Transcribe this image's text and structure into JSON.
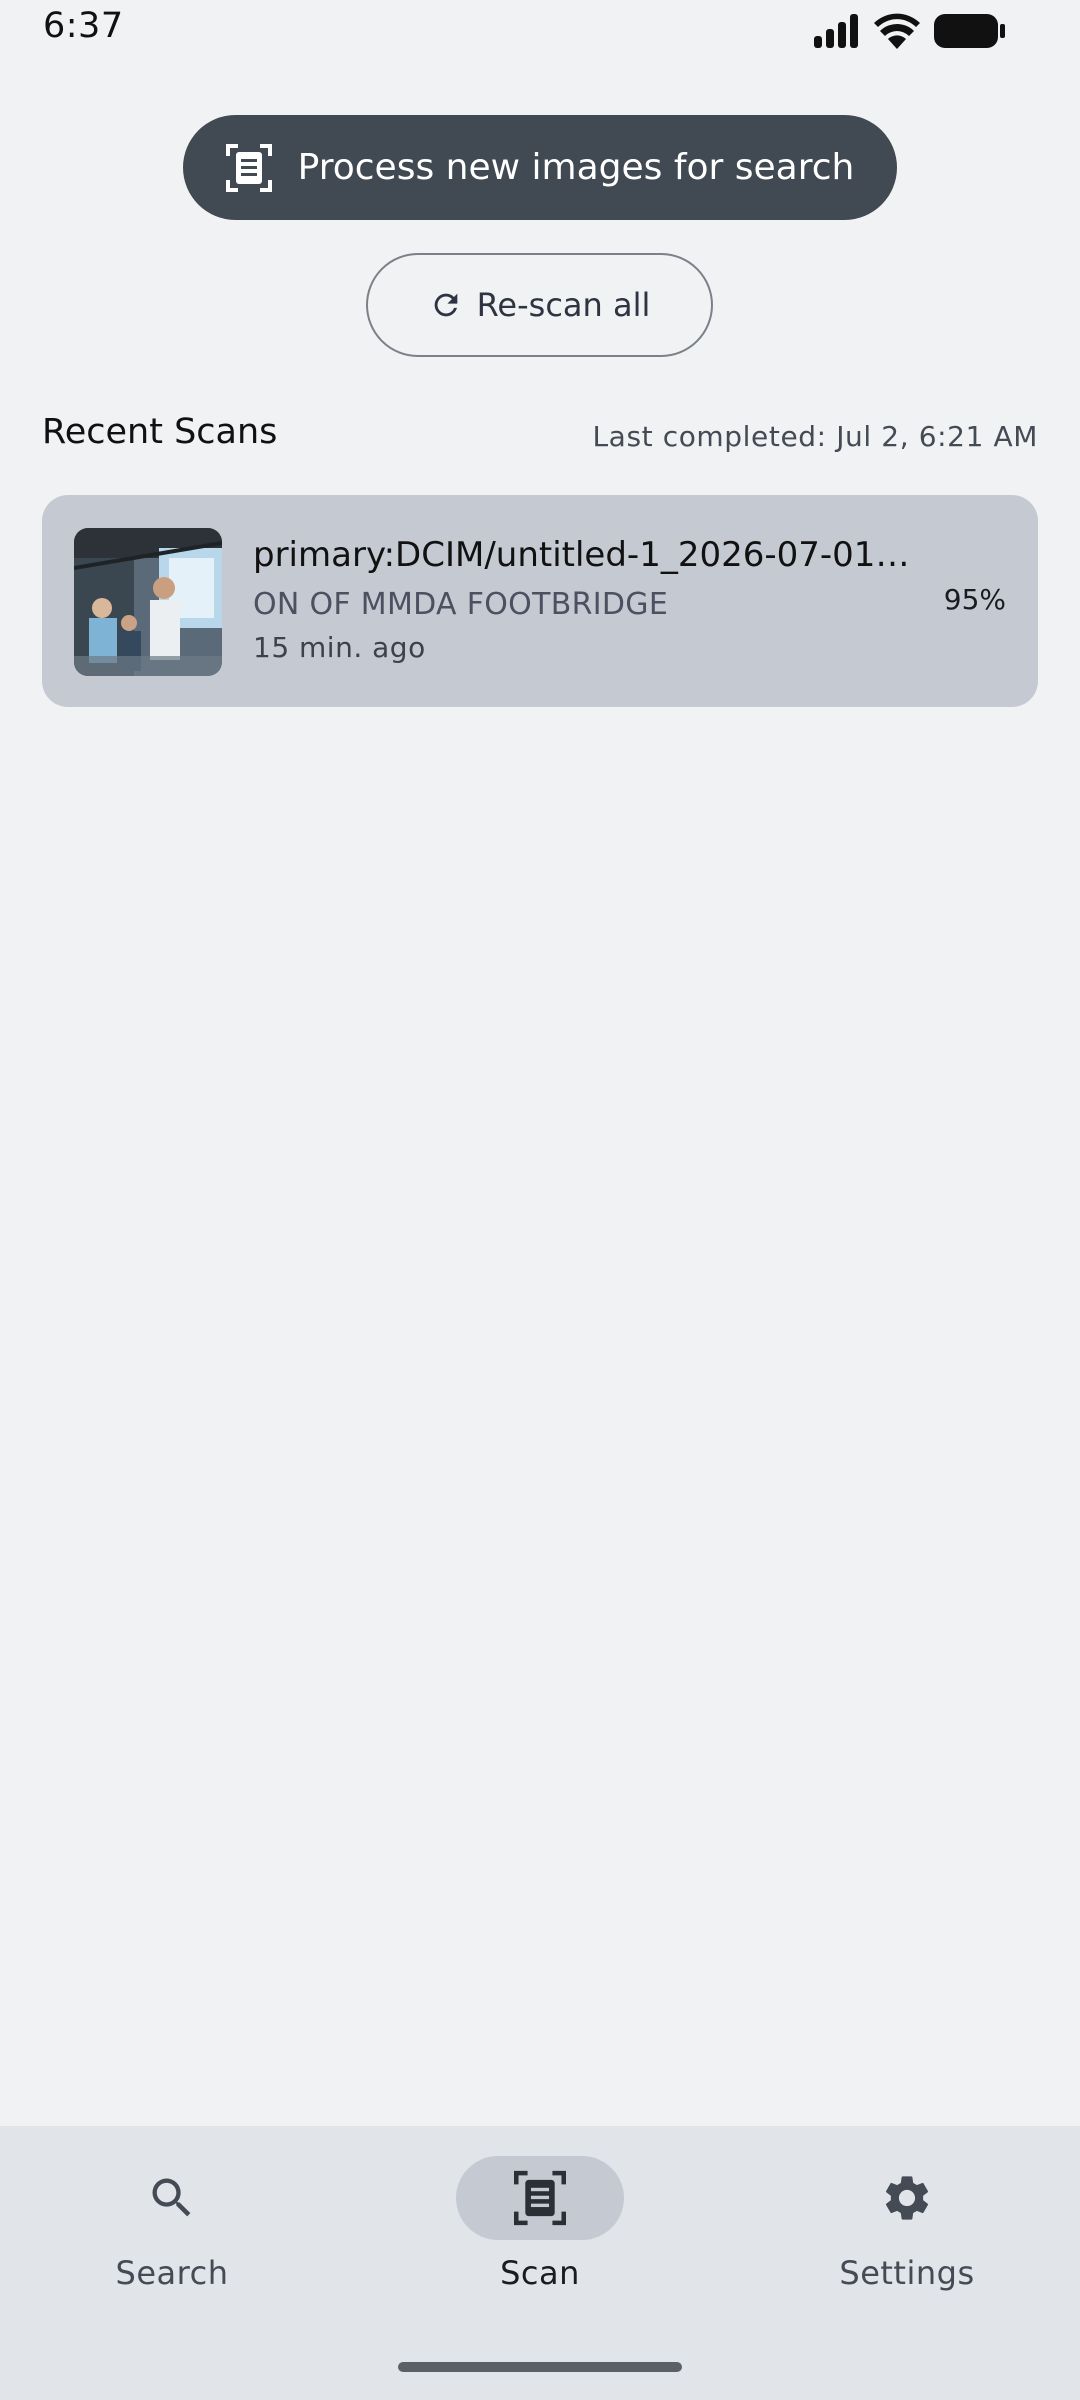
{
  "status_bar": {
    "time": "6:37",
    "icons": [
      "signal-icon",
      "wifi-icon",
      "battery-icon"
    ]
  },
  "actions": {
    "process_label": "Process new images for search",
    "process_icon": "document-scanner-icon",
    "rescan_label": "Re-scan all",
    "rescan_icon": "refresh-icon"
  },
  "recent": {
    "title": "Recent Scans",
    "last_completed": "Last completed: Jul 2, 6:21 AM",
    "items": [
      {
        "title": "primary:DCIM/untitled-1_2026-07-01_2...",
        "subtitle": "ON OF MMDA FOOTBRIDGE",
        "time": "15 min. ago",
        "percent": "95%"
      }
    ]
  },
  "nav": {
    "items": [
      {
        "label": "Search",
        "icon": "search-icon",
        "active": false
      },
      {
        "label": "Scan",
        "icon": "document-scanner-icon",
        "active": true
      },
      {
        "label": "Settings",
        "icon": "gear-icon",
        "active": false
      }
    ]
  },
  "colors": {
    "background": "#f0f2f4",
    "primary_button": "#414952",
    "card": "#c5cad2",
    "nav_background": "#e1e4e9"
  }
}
